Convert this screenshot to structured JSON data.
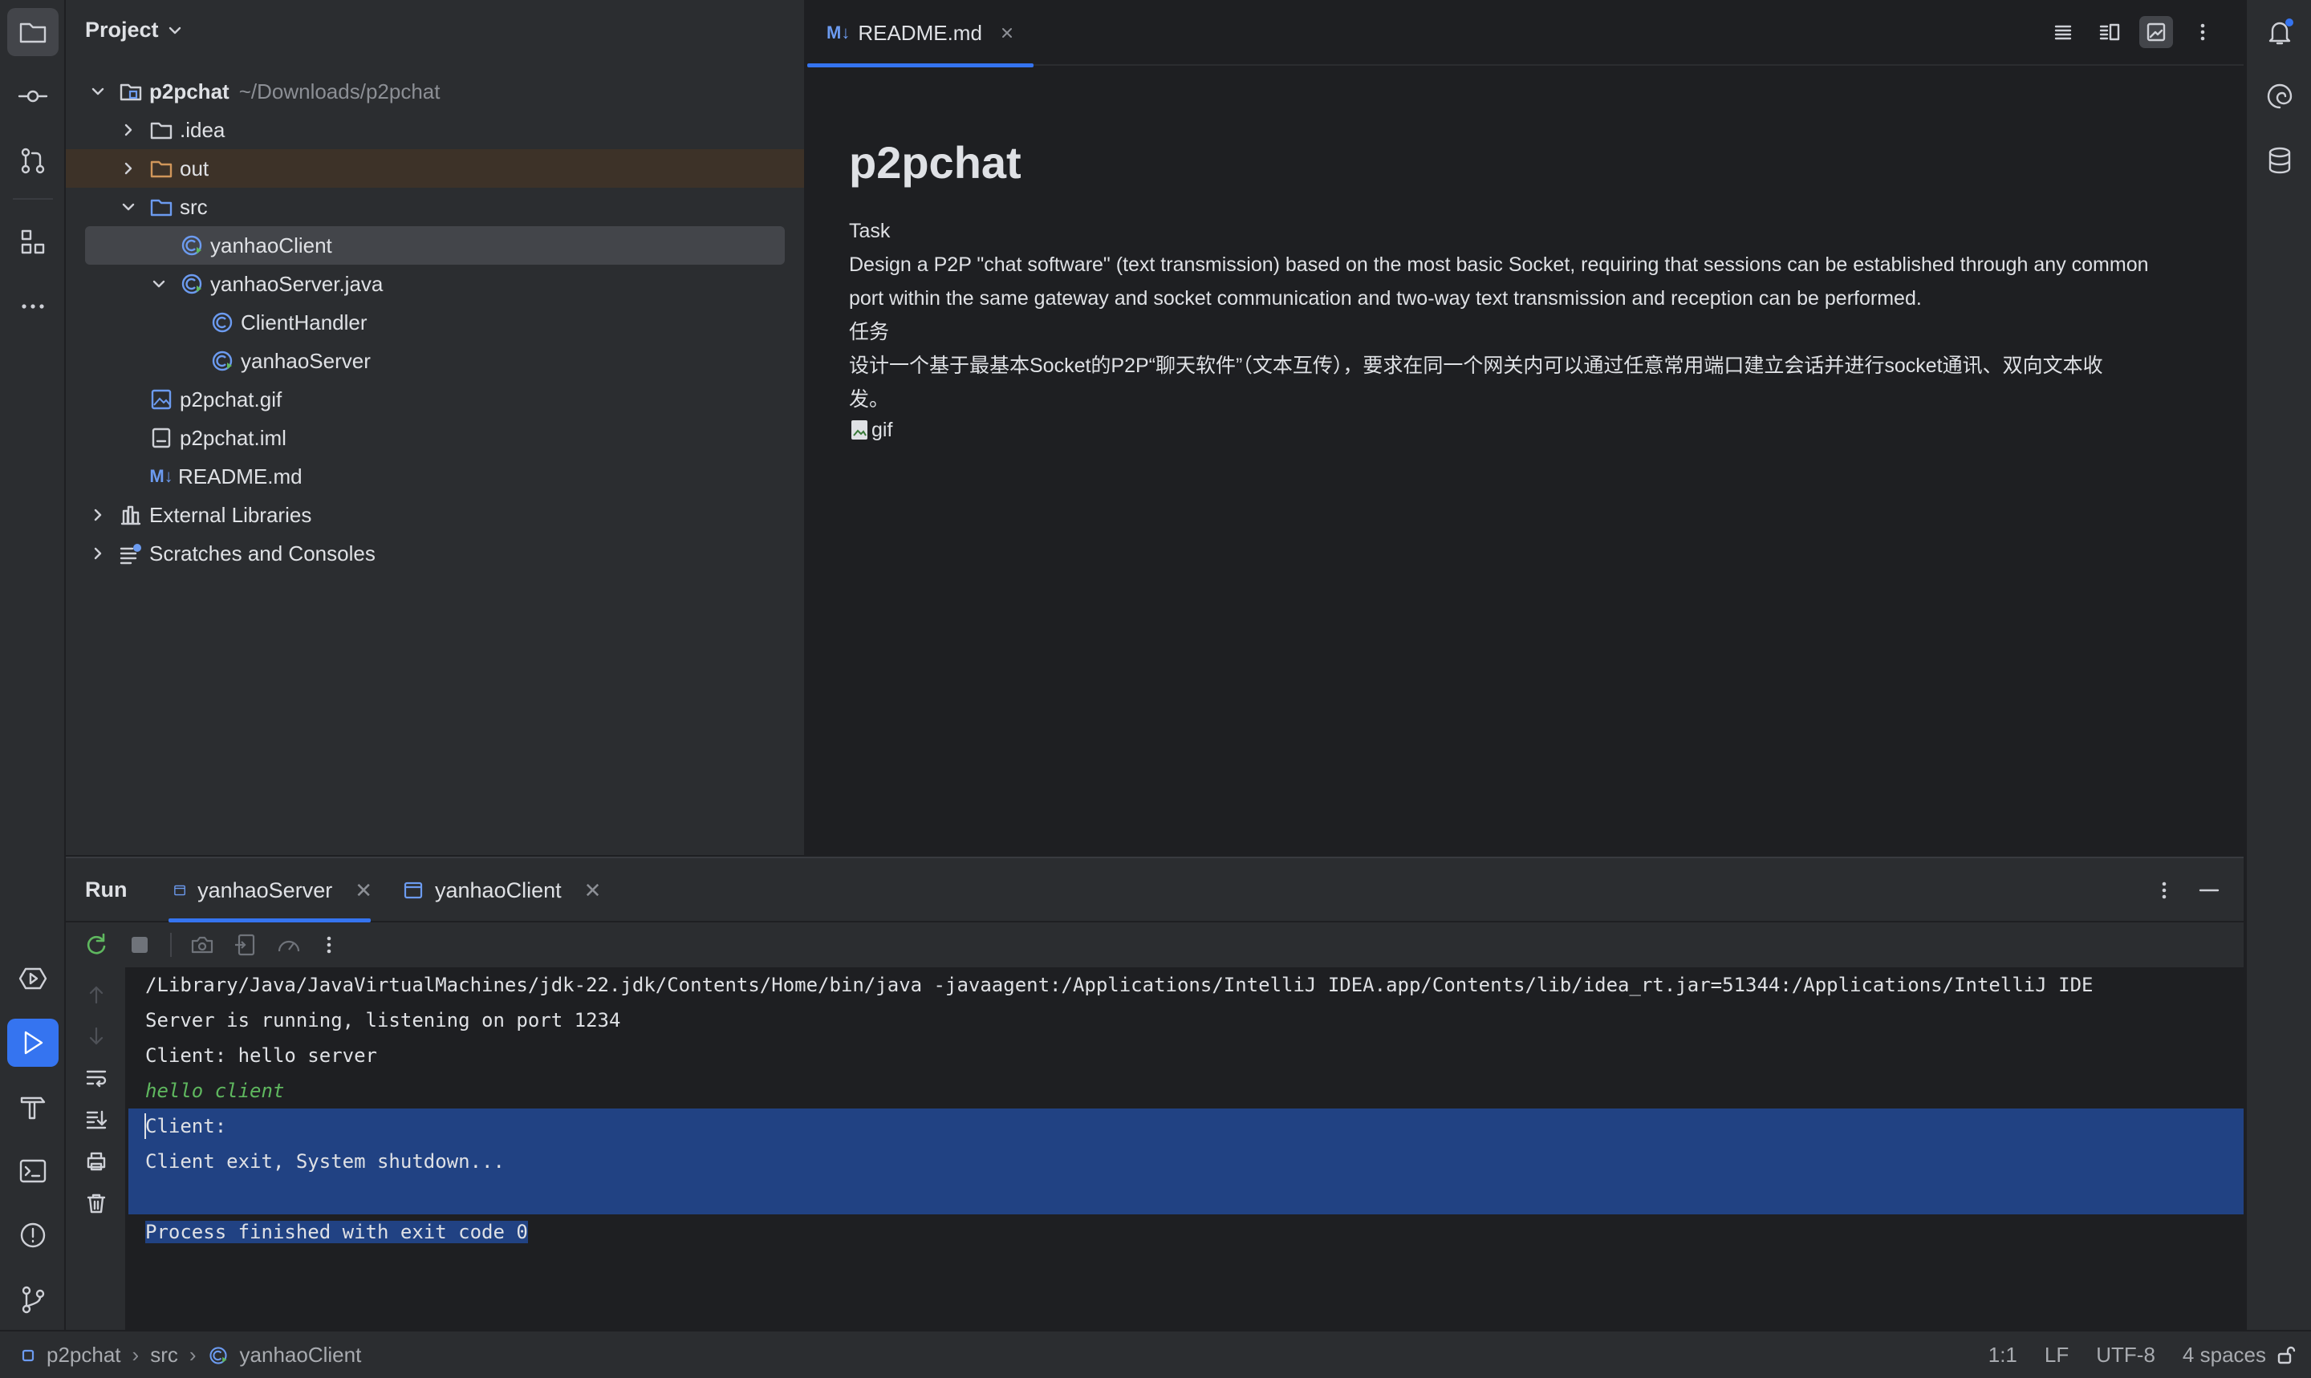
{
  "project_panel": {
    "title": "Project",
    "root": {
      "name": "p2pchat",
      "path": "~/Downloads/p2pchat"
    },
    "items": [
      {
        "label": ".idea"
      },
      {
        "label": "out"
      },
      {
        "label": "src"
      },
      {
        "label": "yanhaoClient"
      },
      {
        "label": "yanhaoServer.java"
      },
      {
        "label": "ClientHandler"
      },
      {
        "label": "yanhaoServer"
      },
      {
        "label": "p2pchat.gif"
      },
      {
        "label": "p2pchat.iml"
      },
      {
        "label": "README.md"
      },
      {
        "label": "External Libraries"
      },
      {
        "label": "Scratches and Consoles"
      }
    ]
  },
  "editor": {
    "tab": {
      "badge": "M↓",
      "label": "README.md"
    },
    "preview": {
      "title": "p2pchat",
      "lines": [
        "Task",
        "Design a P2P \"chat software\" (text transmission) based on the most basic Socket, requiring that sessions can be established through any common",
        "port within the same gateway and socket communication and two-way text transmission and reception can be performed.",
        "任务",
        "设计一个基于最基本Socket的P2P“聊天软件”（文本互传），要求在同一个网关内可以通过任意常用端口建立会话并进行socket通讯、双向文本收",
        "发。"
      ],
      "image_alt": "gif"
    }
  },
  "run_panel": {
    "label": "Run",
    "tabs": [
      {
        "label": "yanhaoServer"
      },
      {
        "label": "yanhaoClient"
      }
    ],
    "console": [
      "/Library/Java/JavaVirtualMachines/jdk-22.jdk/Contents/Home/bin/java -javaagent:/Applications/IntelliJ IDEA.app/Contents/lib/idea_rt.jar=51344:/Applications/IntelliJ IDE",
      "Server is running, listening on port 1234",
      "Client: hello server",
      "hello client",
      "Client:",
      "Client exit, System shutdown...",
      "",
      "Process finished with exit code 0"
    ]
  },
  "status_bar": {
    "breadcrumbs": [
      "p2pchat",
      "src",
      "yanhaoClient"
    ],
    "position": "1:1",
    "line_ending": "LF",
    "encoding": "UTF-8",
    "indent": "4 spaces"
  },
  "colors": {
    "accent": "#3574f0",
    "panel_bg": "#2b2d30",
    "editor_bg": "#1e1f22",
    "selection": "#214283",
    "folder_highlight": "#3d3228"
  }
}
